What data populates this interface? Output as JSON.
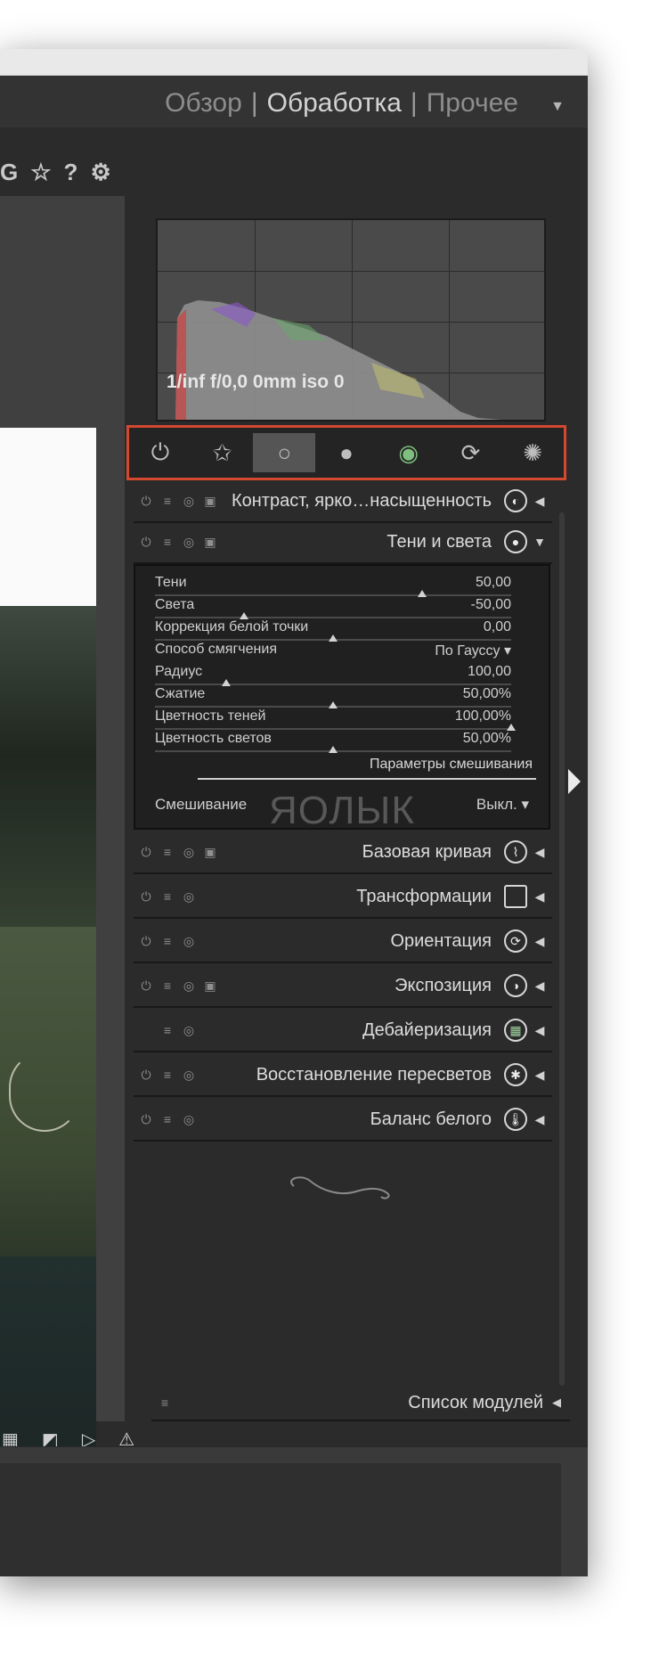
{
  "views": {
    "lighttable": "Обзор",
    "darkroom": "Обработка",
    "other": "Прочее"
  },
  "top_icons": [
    "G",
    "☆",
    "?",
    "⚙"
  ],
  "exif": "1/inf f/0,0 0mm iso 0",
  "group_icons": [
    "power-icon",
    "star-icon",
    "circle-icon",
    "sphere-icon",
    "color-icon",
    "rotate-icon",
    "effect-icon"
  ],
  "modules": {
    "contrast": "Контраст, ярко…насыщенность",
    "shadows_highlights": "Тени и света",
    "base_curve": "Базовая кривая",
    "transform": "Трансформации",
    "orientation": "Ориентация",
    "exposure": "Экспозиция",
    "demosaic": "Дебайеризация",
    "highlight_recovery": "Восстановление пересветов",
    "white_balance": "Баланс белого"
  },
  "params": [
    {
      "label": "Тени",
      "value": "50,00",
      "marker": 0.75
    },
    {
      "label": "Света",
      "value": "-50,00",
      "marker": 0.25
    },
    {
      "label": "Коррекция белой точки",
      "value": "0,00",
      "marker": 0.5
    },
    {
      "label": "Способ смягчения",
      "value": "По Гауссу ▾",
      "marker": null
    },
    {
      "label": "Радиус",
      "value": "100,00",
      "marker": 0.2
    },
    {
      "label": "Сжатие",
      "value": "50,00%",
      "marker": 0.5
    },
    {
      "label": "Цветность теней",
      "value": "100,00%",
      "marker": 1.0
    },
    {
      "label": "Цветность светов",
      "value": "50,00%",
      "marker": 0.5
    }
  ],
  "blend": {
    "link": "Параметры смешивания",
    "label": "Смешивание",
    "value": "Выкл. ▾"
  },
  "watermark": "ЯОЛЫК",
  "module_list": "Список модулей"
}
